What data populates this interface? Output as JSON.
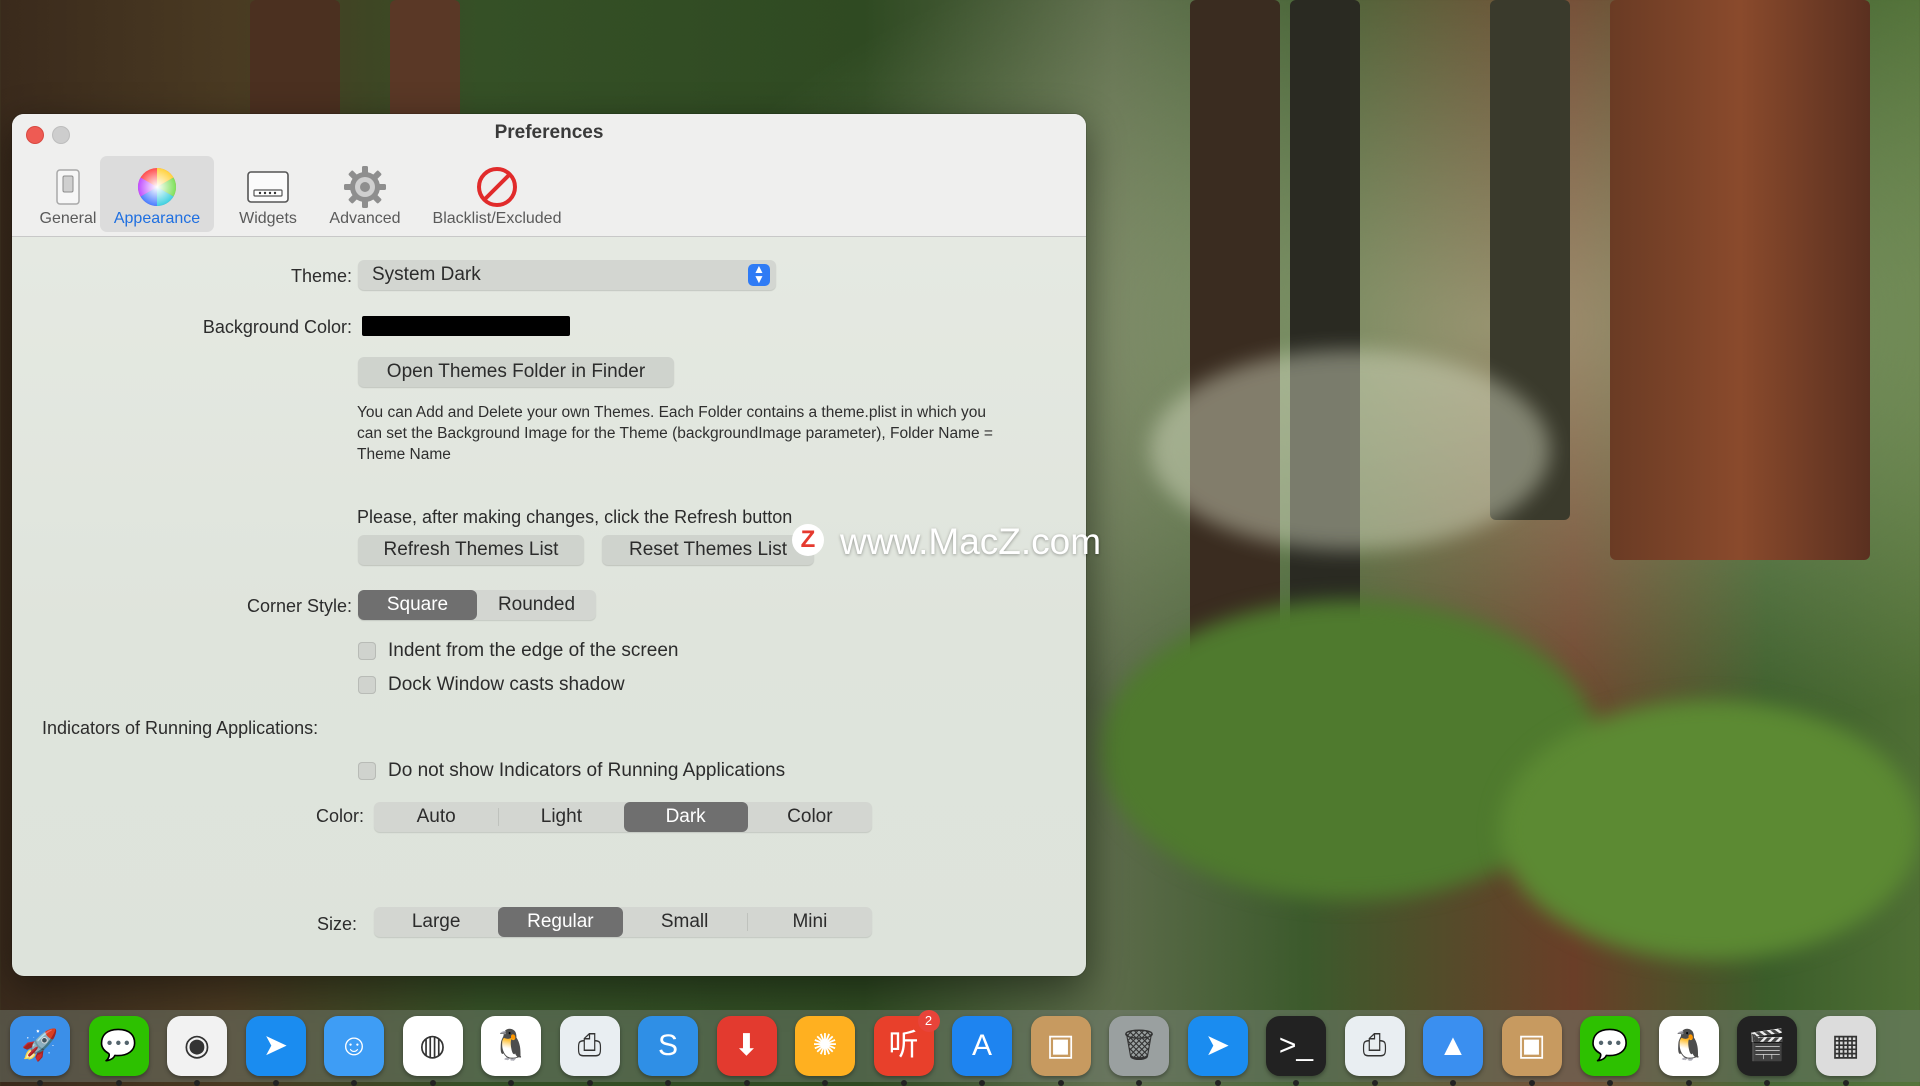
{
  "window": {
    "title": "Preferences",
    "toolbar": [
      {
        "label": "General",
        "icon": "switch-icon"
      },
      {
        "label": "Appearance",
        "icon": "color-wheel-icon"
      },
      {
        "label": "Widgets",
        "icon": "widgets-icon"
      },
      {
        "label": "Advanced",
        "icon": "gear-icon"
      },
      {
        "label": "Blacklist/Excluded",
        "icon": "prohibited-icon"
      }
    ],
    "selected_tab": "Appearance"
  },
  "form": {
    "theme_label": "Theme:",
    "theme_value": "System Dark",
    "background_label": "Background Color:",
    "background_color": "#000000",
    "open_folder_button": "Open Themes Folder in Finder",
    "help_text": "You can Add and Delete  your own Themes. Each Folder contains a theme.plist in which you can set the Background Image for the Theme (backgroundImage parameter), Folder Name = Theme Name",
    "refresh_note": "Please, after making changes, click the Refresh button",
    "refresh_button": "Refresh Themes List",
    "reset_button": "Reset Themes List",
    "corner_label": "Corner Style:",
    "corner_options": [
      "Square",
      "Rounded"
    ],
    "corner_selected": "Square",
    "indent_checkbox": "Indent from the edge of the screen",
    "shadow_checkbox": "Dock Window casts shadow",
    "indicators_label": "Indicators of Running Applications:",
    "indicators_checkbox": "Do not show Indicators of Running Applications",
    "color_label": "Color:",
    "color_options": [
      "Auto",
      "Light",
      "Dark",
      "Color"
    ],
    "color_selected": "Dark",
    "size_label": "Size:",
    "size_options": [
      "Large",
      "Regular",
      "Small",
      "Mini"
    ],
    "size_selected": "Regular"
  },
  "watermark": {
    "logo": "Z",
    "text": "www.MacZ.com"
  },
  "dock": {
    "apps": [
      {
        "name": "rocket-icon",
        "color": "#3b8fe8"
      },
      {
        "name": "wechat-icon",
        "color": "#2dc100"
      },
      {
        "name": "chrome-icon",
        "color": "#f2f2f2"
      },
      {
        "name": "paper-plane-icon",
        "color": "#1a8cf0"
      },
      {
        "name": "finder-icon",
        "color": "#3e9df5"
      },
      {
        "name": "qq-browser-icon",
        "color": "#ffffff"
      },
      {
        "name": "qq-penguin-icon",
        "color": "#ffffff"
      },
      {
        "name": "printer-icon",
        "color": "#e9eef2"
      },
      {
        "name": "s-icon",
        "color": "#2f8fe6"
      },
      {
        "name": "download-icon",
        "color": "#e33a2f"
      },
      {
        "name": "pinwheel-icon",
        "color": "#ffb020"
      },
      {
        "name": "news-icon",
        "color": "#e8402b"
      },
      {
        "name": "app-store-icon",
        "color": "#1e84f0"
      },
      {
        "name": "package-icon",
        "color": "#c79a60"
      },
      {
        "name": "trash-icon",
        "color": "#9aa0a0"
      },
      {
        "name": "paper-plane-icon",
        "color": "#1a8cf0"
      },
      {
        "name": "terminal-icon",
        "color": "#222222"
      },
      {
        "name": "printer-icon",
        "color": "#e9eef2"
      },
      {
        "name": "altimeter-icon",
        "color": "#3a8ff0"
      },
      {
        "name": "package-icon",
        "color": "#c79a60"
      },
      {
        "name": "wechat-icon",
        "color": "#2dc100"
      },
      {
        "name": "qq-penguin-icon",
        "color": "#ffffff"
      },
      {
        "name": "final-cut-icon",
        "color": "#222222"
      },
      {
        "name": "calculator-icon",
        "color": "#dcdcdc"
      }
    ],
    "badge": "2"
  }
}
